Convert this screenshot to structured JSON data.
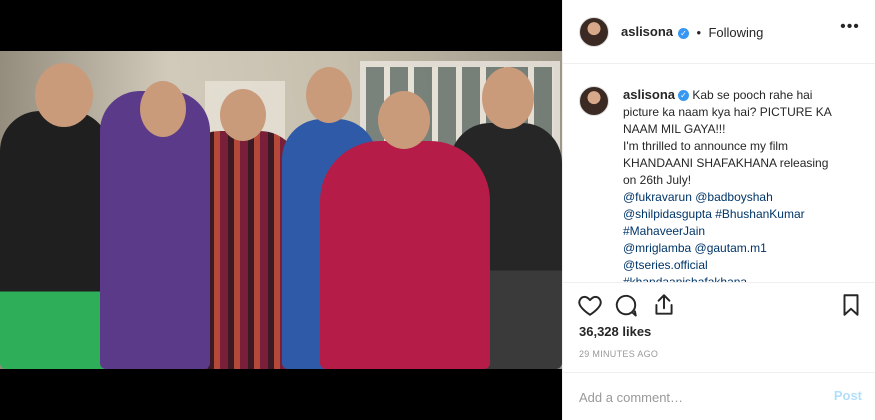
{
  "header": {
    "username": "aslisona",
    "separator": "•",
    "follow_status": "Following",
    "more_icon": "more-options-icon"
  },
  "caption": {
    "username": "aslisona",
    "lines": [
      "Kab se pooch rahe hai",
      "picture ka naam kya hai? PICTURE KA",
      "NAAM MIL GAYA!!!",
      "I'm thrilled to announce my film",
      "KHANDAANI SHAFAKHANA releasing",
      "on 26th July!"
    ],
    "tags": [
      "@fukravarun @badboyshah",
      "@shilpidasgupta #BhushanKumar",
      "#MahaveerJain",
      "@mriglamba @gautam.m1",
      "@tseries.official",
      "#khandaanishafakhana"
    ]
  },
  "stats": {
    "likes": "36,328 likes",
    "time": "29 MINUTES AGO"
  },
  "comment_box": {
    "placeholder": "Add a comment…",
    "post_label": "Post"
  },
  "colors": {
    "verified_badge": "#3897f0",
    "post_button_disabled": "#b2dffc",
    "hashtag": "#003569"
  },
  "icons": [
    "heart-icon",
    "comment-bubble-icon",
    "share-icon",
    "bookmark-icon",
    "verified-badge-icon"
  ]
}
